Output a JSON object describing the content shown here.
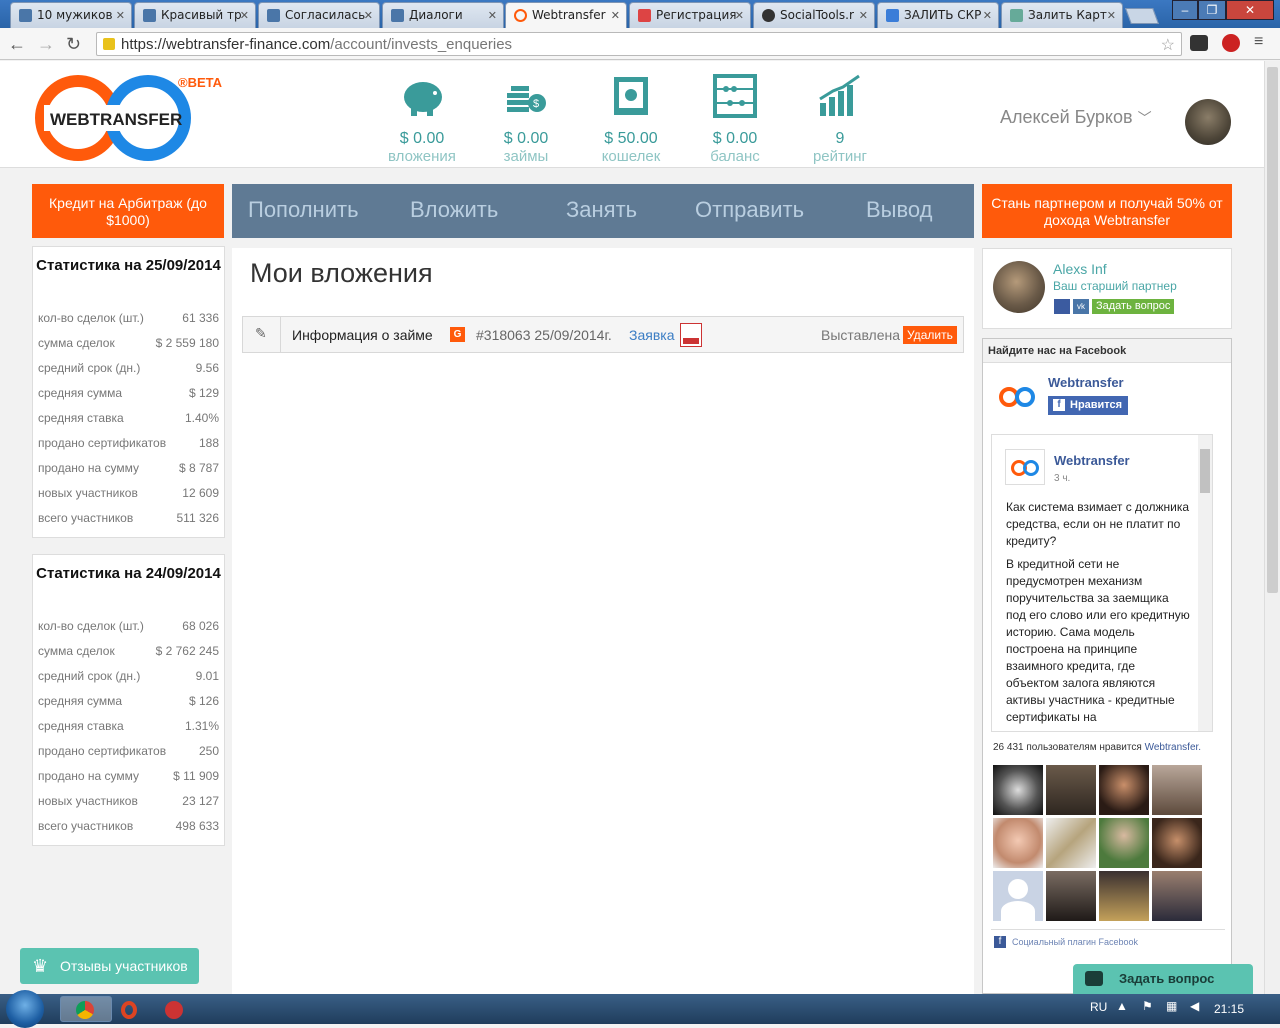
{
  "browser": {
    "tabs": [
      {
        "label": "10 мужиков",
        "fav": "#4a76a8"
      },
      {
        "label": "Красивый тр",
        "fav": "#4a76a8"
      },
      {
        "label": "Согласилась",
        "fav": "#4a76a8"
      },
      {
        "label": "Диалоги",
        "fav": "#4a76a8"
      },
      {
        "label": "Webtransfer",
        "fav": "#ff5a0b"
      },
      {
        "label": "Регистрация",
        "fav": "#d44"
      },
      {
        "label": "SocialTools.r",
        "fav": "#333"
      },
      {
        "label": "ЗАЛИТЬ СКР",
        "fav": "#3b7dd8"
      },
      {
        "label": "Залить Карт",
        "fav": "#6a9"
      }
    ],
    "url_host": "https://webtransfer-finance.com",
    "url_path": "/account/invests_enqueries"
  },
  "header": {
    "logo_text": "WEBTRANSFER",
    "beta": "®BETA",
    "stats": [
      {
        "value": "$ 0.00",
        "label": "вложения",
        "icon": "piggy-bank-icon"
      },
      {
        "value": "$ 0.00",
        "label": "займы",
        "icon": "coins-icon"
      },
      {
        "value": "$ 50.00",
        "label": "кошелек",
        "icon": "safe-icon"
      },
      {
        "value": "$ 0.00",
        "label": "баланс",
        "icon": "abacus-icon"
      },
      {
        "value": "9",
        "label": "рейтинг",
        "icon": "rating-chart-icon"
      }
    ],
    "user_name": "Алексей Бурков"
  },
  "left_button": "Кредит на Арбитраж (до $1000)",
  "menu": [
    "Пополнить",
    "Вложить",
    "Занять",
    "Отправить",
    "Вывод"
  ],
  "right_button": "Стань партнером и получай 50% от дохода Webtransfer",
  "stats_blocks": [
    {
      "title": "Статистика на 25/09/2014",
      "rows": [
        [
          "кол-во сделок (шт.)",
          "61 336"
        ],
        [
          "сумма сделок",
          "$ 2 559 180"
        ],
        [
          "средний срок (дн.)",
          "9.56"
        ],
        [
          "средняя сумма",
          "$ 129"
        ],
        [
          "средняя ставка",
          "1.40%"
        ],
        [
          "продано сертификатов",
          "188"
        ],
        [
          "продано на сумму",
          "$ 8 787"
        ],
        [
          "новых участников",
          "12 609"
        ],
        [
          "всего участников",
          "511 326"
        ]
      ]
    },
    {
      "title": "Статистика на 24/09/2014",
      "rows": [
        [
          "кол-во сделок (шт.)",
          "68 026"
        ],
        [
          "сумма сделок",
          "$ 2 762 245"
        ],
        [
          "средний срок (дн.)",
          "9.01"
        ],
        [
          "средняя сумма",
          "$ 126"
        ],
        [
          "средняя ставка",
          "1.31%"
        ],
        [
          "продано сертификатов",
          "250"
        ],
        [
          "продано на сумму",
          "$ 11 909"
        ],
        [
          "новых участников",
          "23 127"
        ],
        [
          "всего участников",
          "498 633"
        ]
      ]
    }
  ],
  "main": {
    "title": "Мои вложения",
    "loan": {
      "info": "Информация о займе",
      "badge": "G",
      "number": "#318063 25/09/2014г.",
      "link": "Заявка",
      "status": "Выставлена",
      "delete": "Удалить"
    }
  },
  "partner": {
    "name": "Alexs Inf",
    "role": "Ваш старший партнер",
    "ask": "Задать вопрос"
  },
  "facebook": {
    "header": "Найдите нас на Facebook",
    "page_name": "Webtransfer",
    "like": "Нравится",
    "post_author": "Webtransfer",
    "post_time": "3 ч.",
    "post_q": "Как система взимает с должника средства, если он не платит по кредиту?",
    "post_a": "В кредитной сети не предусмотрен механизм поручительства за заемщика под его слово или его кредитную историю. Сама модель построена на принципе взаимного кредита, где объектом залога являются активы участника - кредитные сертификаты на",
    "likes_count": "26 431 пользователям нравится",
    "likes_page": "Webtransfer.",
    "plugin": "Социальный плагин Facebook"
  },
  "feedback": "Отзывы участников",
  "ask_question": "Задать вопрос",
  "taskbar": {
    "lang": "RU",
    "time": "21:15"
  }
}
